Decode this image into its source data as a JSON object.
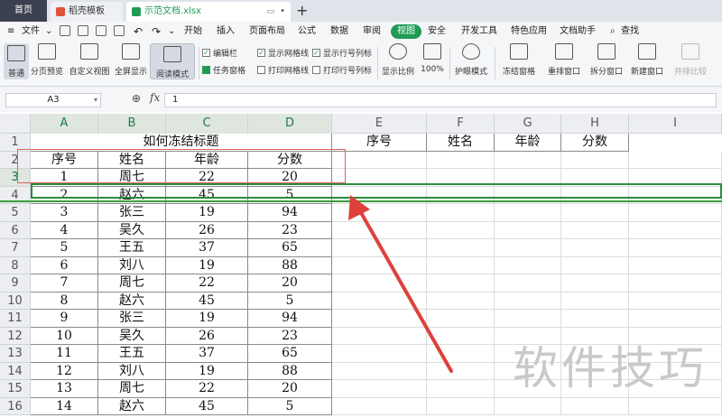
{
  "tabs": {
    "home": "首页",
    "template": "稻壳模板",
    "file": "示范文档.xlsx",
    "add": "+"
  },
  "menu": {
    "file": "文件",
    "items": [
      "开始",
      "插入",
      "页面布局",
      "公式",
      "数据",
      "审阅",
      "视图",
      "安全",
      "开发工具",
      "特色应用",
      "文档助手"
    ],
    "active": "视图",
    "search": "查找"
  },
  "ribbon": {
    "normal": "普通",
    "page_break": "分页预览",
    "custom_view": "自定义视图",
    "fullscreen": "全屏显示",
    "reading_mode": "阅读模式",
    "edit_bar": "编辑栏",
    "task_pane": "任务窗格",
    "show_gridlines": "显示网格线",
    "print_gridlines": "打印网格线",
    "show_headers": "显示行号列标",
    "print_headers": "打印行号列标",
    "zoom": "显示比例",
    "zoom_100": "100%",
    "eye_protect": "护眼模式",
    "freeze": "冻结窗格",
    "arrange": "重排窗口",
    "split": "拆分窗口",
    "new_window": "新建窗口",
    "side_by_side": "并排比较"
  },
  "formula_bar": {
    "name_box": "A3",
    "fx": "fx",
    "value": "1"
  },
  "columns": [
    "A",
    "B",
    "C",
    "D",
    "E",
    "F",
    "G",
    "H",
    "I"
  ],
  "rows": [
    "1",
    "2",
    "3",
    "4",
    "5",
    "6",
    "7",
    "8",
    "9",
    "10",
    "11",
    "12",
    "13",
    "14",
    "15",
    "16"
  ],
  "sheet": {
    "title": "如何冻结标题",
    "headers": [
      "序号",
      "姓名",
      "年龄",
      "分数"
    ],
    "right_headers": [
      "序号",
      "姓名",
      "年龄",
      "分数"
    ],
    "data": [
      [
        "1",
        "周七",
        "22",
        "20"
      ],
      [
        "2",
        "赵六",
        "45",
        "5"
      ],
      [
        "3",
        "张三",
        "19",
        "94"
      ],
      [
        "4",
        "吴久",
        "26",
        "23"
      ],
      [
        "5",
        "王五",
        "37",
        "65"
      ],
      [
        "6",
        "刘八",
        "19",
        "88"
      ],
      [
        "7",
        "周七",
        "22",
        "20"
      ],
      [
        "8",
        "赵六",
        "45",
        "5"
      ],
      [
        "9",
        "张三",
        "19",
        "94"
      ],
      [
        "10",
        "吴久",
        "26",
        "23"
      ],
      [
        "11",
        "王五",
        "37",
        "65"
      ],
      [
        "12",
        "刘八",
        "19",
        "88"
      ],
      [
        "13",
        "周七",
        "22",
        "20"
      ],
      [
        "14",
        "赵六",
        "45",
        "5"
      ]
    ]
  },
  "watermark": "软件技巧",
  "colors": {
    "accent": "#1f9b54",
    "arrow": "#e0403a",
    "selection": "#2d8c3c"
  }
}
